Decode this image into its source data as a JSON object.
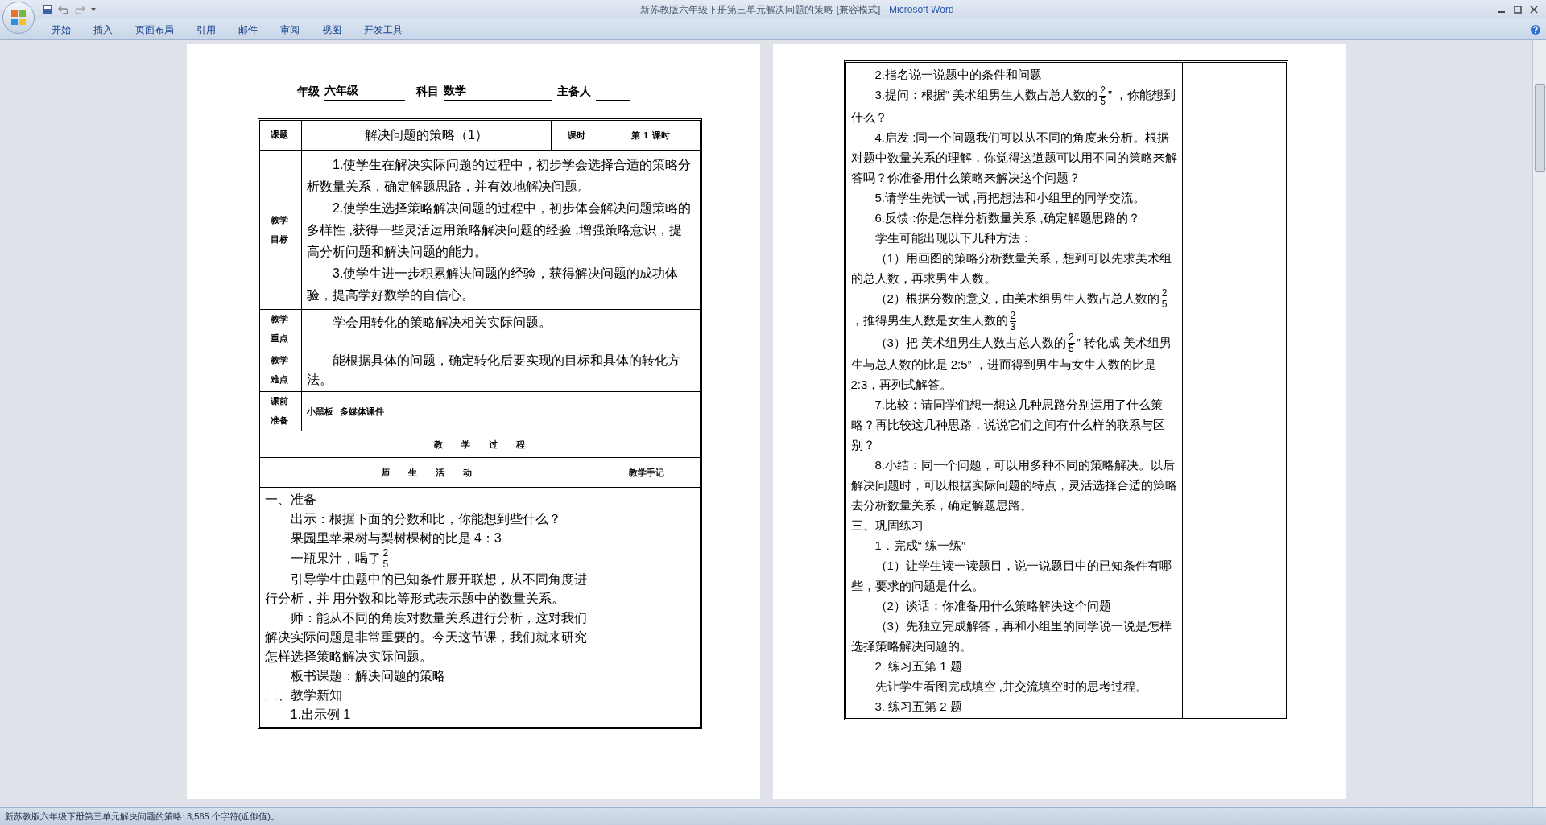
{
  "window": {
    "title": "新苏教版六年级下册第三单元解决问题的策略 [兼容模式]",
    "app_name": " - Microsoft Word"
  },
  "ribbon_tabs": [
    {
      "label": "开始"
    },
    {
      "label": "插入"
    },
    {
      "label": "页面布局"
    },
    {
      "label": "引用"
    },
    {
      "label": "邮件"
    },
    {
      "label": "审阅"
    },
    {
      "label": "视图"
    },
    {
      "label": "开发工具"
    }
  ],
  "header": {
    "grade_label": "年级",
    "grade": "六年级",
    "subject_label": "科目",
    "subject": "数学",
    "preparer_label": "主备人"
  },
  "lesson_table": {
    "topic_label": "课题",
    "topic": "解决问题的策略（1）",
    "period_label": "课时",
    "period": "第 1 课时",
    "goals_label": "教学目标",
    "goals": [
      {
        "indent": true,
        "parts": [
          {
            "kind": "text",
            "text": "1.使学生在解决实际问题的过程中，初步学会选择合适的策略分析数量关系，确定解题思路，并有效地解决问题。"
          }
        ]
      },
      {
        "indent": true,
        "parts": [
          {
            "kind": "text",
            "text": "2.使学生选择策略解决问题的过程中，初步体会解决问题策略的多样性 ,获得一些灵活运用策略解决问题的经验 ,增强策略意识，提高分析问题和解决问题的能力。"
          }
        ]
      },
      {
        "indent": true,
        "parts": [
          {
            "kind": "text",
            "text": "3.使学生进一步积累解决问题的经验，获得解决问题的成功体验，提高学好数学的自信心。"
          }
        ]
      }
    ],
    "key_point_label": "教学重点",
    "key_point": "学会用转化的策略解决相关实际问题。",
    "difficulty_label": "教学难点",
    "difficulty": "能根据具体的问题，确定转化后要实现的目标和具体的转化方法。",
    "preparation_label": "课前准备",
    "preparation": "小黑板  多媒体课件",
    "process_heading": "教 学 过 程",
    "activity_heading": "师 生 活 动",
    "notes_heading": "教学手记",
    "process": [
      {
        "indent": false,
        "parts": [
          {
            "kind": "text",
            "text": "一、准备"
          }
        ]
      },
      {
        "indent": true,
        "parts": [
          {
            "kind": "text",
            "text": "出示：根据下面的分数和比，你能想到些什么？"
          }
        ]
      },
      {
        "indent": true,
        "parts": [
          {
            "kind": "text",
            "text": "果园里苹果树与梨树棵树的比是 4：3"
          }
        ]
      },
      {
        "indent": true,
        "parts": [
          {
            "kind": "text",
            "text": "一瓶果汁，喝了"
          },
          {
            "kind": "fraction",
            "numerator": "2",
            "denominator": "5"
          }
        ]
      },
      {
        "indent": true,
        "parts": [
          {
            "kind": "text",
            "text": "引导学生由题中的已知条件展开联想，从不同角度进行分析，并  用分数和比等形式表示题中的数量关系。"
          }
        ]
      },
      {
        "indent": true,
        "parts": [
          {
            "kind": "text",
            "text": "师：能从不同的角度对数量关系进行分析，这对我们解决实际问题是非常重要的。今天这节课，我们就来研究怎样选择策略解决实际问题。"
          }
        ]
      },
      {
        "indent": true,
        "parts": [
          {
            "kind": "text",
            "text": "板书课题：解决问题的策略"
          }
        ]
      },
      {
        "indent": false,
        "parts": [
          {
            "kind": "text",
            "text": "二、教学新知"
          }
        ]
      },
      {
        "indent": true,
        "parts": [
          {
            "kind": "text",
            "text": "1.出示例 1"
          }
        ]
      }
    ]
  },
  "continued_table": {
    "process": [
      {
        "indent": true,
        "parts": [
          {
            "kind": "text",
            "text": "2.指名说一说题中的条件和问题"
          }
        ]
      },
      {
        "indent": true,
        "parts": [
          {
            "kind": "text",
            "text": "3.提问：根据“ 美术组男生人数占总人数的"
          },
          {
            "kind": "fraction",
            "numerator": "2",
            "denominator": "5"
          },
          {
            "kind": "text",
            "text": "”  ，你能想到什么？"
          }
        ]
      },
      {
        "indent": true,
        "parts": [
          {
            "kind": "text",
            "text": "4.启发 :同一个问题我们可以从不同的角度来分析。根据对题中数量关系的理解，你觉得这道题可以用不同的策略来解答吗？你准备用什么策略来解决这个问题？"
          }
        ]
      },
      {
        "indent": true,
        "parts": [
          {
            "kind": "text",
            "text": "5.请学生先试一试 ,再把想法和小组里的同学交流。"
          }
        ]
      },
      {
        "indent": true,
        "parts": [
          {
            "kind": "text",
            "text": "6.反馈 :你是怎样分析数量关系 ,确定解题思路的？"
          }
        ]
      },
      {
        "indent": true,
        "parts": [
          {
            "kind": "text",
            "text": "学生可能出现以下几种方法："
          }
        ]
      },
      {
        "indent": true,
        "parts": [
          {
            "kind": "text",
            "text": "（1）用画图的策略分析数量关系，想到可以先求美术组的总人数，再求男生人数。"
          }
        ]
      },
      {
        "indent": true,
        "parts": [
          {
            "kind": "text",
            "text": "（2）根据分数的意义，由美术组男生人数占总人数的"
          },
          {
            "kind": "fraction",
            "numerator": "2",
            "denominator": "5"
          },
          {
            "kind": "text",
            "text": "，推得男生人数是女生人数的"
          },
          {
            "kind": "fraction",
            "numerator": "2",
            "denominator": "3"
          }
        ]
      },
      {
        "indent": true,
        "parts": [
          {
            "kind": "text",
            "text": "（3）把  美术组男生人数占总人数的"
          },
          {
            "kind": "fraction",
            "numerator": "2",
            "denominator": "5"
          },
          {
            "kind": "text",
            "text": "” 转化成  美术组男生与总人数的比是 2:5” ，进而得到男生与女生人数的比是 2:3，再列式解答。"
          }
        ]
      },
      {
        "indent": true,
        "parts": [
          {
            "kind": "text",
            "text": "7.比较：请同学们想一想这几种思路分别运用了什么策略？再比较这几种思路，说说它们之间有什么样的联系与区别？"
          }
        ]
      },
      {
        "indent": true,
        "parts": [
          {
            "kind": "text",
            "text": "8.小结：同一个问题，可以用多种不同的策略解决。以后解决问题时，可以根据实际问题的特点，灵活选择合适的策略去分析数量关系，确定解题思路。"
          }
        ]
      },
      {
        "indent": false,
        "parts": [
          {
            "kind": "text",
            "text": "三、巩固练习"
          }
        ]
      },
      {
        "indent": true,
        "parts": [
          {
            "kind": "text",
            "text": "1．完成“ 练一练”"
          }
        ]
      },
      {
        "indent": true,
        "parts": [
          {
            "kind": "text",
            "text": "（1）让学生读一读题目，说一说题目中的已知条件有哪些，要求的问题是什么。"
          }
        ]
      },
      {
        "indent": true,
        "parts": [
          {
            "kind": "text",
            "text": "（2）谈话：你准备用什么策略解决这个问题"
          }
        ]
      },
      {
        "indent": true,
        "parts": [
          {
            "kind": "text",
            "text": "（3）先独立完成解答，再和小组里的同学说一说是怎样选择策略解决问题的。"
          }
        ]
      },
      {
        "indent": true,
        "parts": [
          {
            "kind": "text",
            "text": "2. 练习五第 1 题"
          }
        ]
      },
      {
        "indent": true,
        "parts": [
          {
            "kind": "text",
            "text": "先让学生看图完成填空 ,并交流填空时的思考过程。"
          }
        ]
      },
      {
        "indent": true,
        "parts": [
          {
            "kind": "text",
            "text": "3. 练习五第 2 题"
          }
        ]
      }
    ]
  },
  "status_bar": {
    "text": "新苏教版六年级下册第三单元解决问题的策略: 3,565 个字符(近似值)。"
  }
}
